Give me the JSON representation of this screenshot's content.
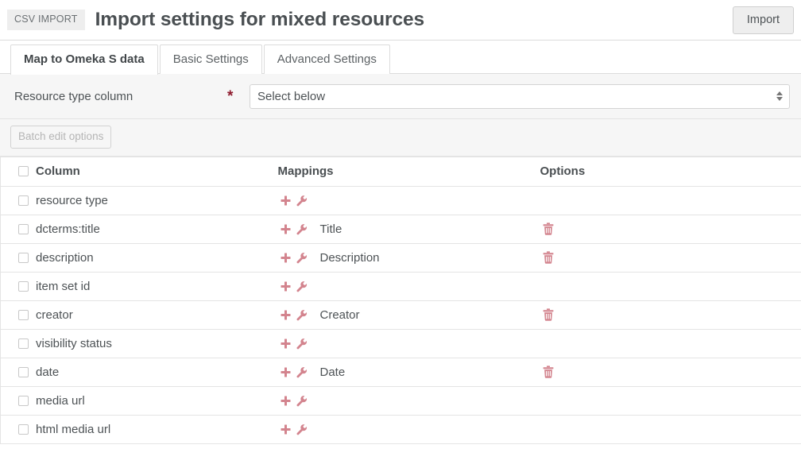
{
  "header": {
    "badge": "CSV IMPORT",
    "title": "Import settings for mixed resources",
    "import_label": "Import",
    "accent_color": "#d3848e",
    "required_color": "#8e1b2e"
  },
  "tabs": [
    {
      "label": "Map to Omeka S data",
      "active": true
    },
    {
      "label": "Basic Settings",
      "active": false
    },
    {
      "label": "Advanced Settings",
      "active": false
    }
  ],
  "resource_type_field": {
    "label": "Resource type column",
    "required_marker": "*",
    "selected_value": "Select below"
  },
  "batch": {
    "button_label": "Batch edit options",
    "disabled": true
  },
  "table": {
    "headers": {
      "column": "Column",
      "mappings": "Mappings",
      "options": "Options"
    },
    "rows": [
      {
        "column": "resource type",
        "mapping": "",
        "has_delete": false
      },
      {
        "column": "dcterms:title",
        "mapping": "Title",
        "has_delete": true
      },
      {
        "column": "description",
        "mapping": "Description",
        "has_delete": true
      },
      {
        "column": "item set id",
        "mapping": "",
        "has_delete": false
      },
      {
        "column": "creator",
        "mapping": "Creator",
        "has_delete": true
      },
      {
        "column": "visibility status",
        "mapping": "",
        "has_delete": false
      },
      {
        "column": "date",
        "mapping": "Date",
        "has_delete": true
      },
      {
        "column": "media url",
        "mapping": "",
        "has_delete": false
      },
      {
        "column": "html media url",
        "mapping": "",
        "has_delete": false
      }
    ]
  }
}
